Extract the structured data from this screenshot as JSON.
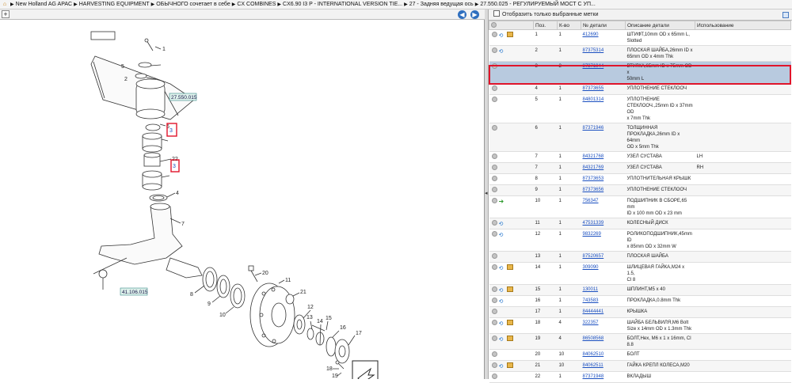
{
  "breadcrumb": [
    "New Holland AG APAC",
    "HARVESTING EQUIPMENT",
    "ОБЫЧНОГО сочетает в себе",
    "CX COMBINES",
    "CX6.90 I3 P - INTERNATIONAL VERSION TIE...",
    "27 - Задняя ведущая ось",
    "27.550.025 - РЕГУЛИРУЕМЫЙ МОСТ С УП..."
  ],
  "icons": {
    "home": "home-icon",
    "zoom": "zoom-plus-icon",
    "back": "arrow-left-icon",
    "fwd": "arrow-right-icon"
  },
  "filter_label": "Отобразить только выбранные метки",
  "columns": [
    "Поз.",
    "К-во",
    "№ детали",
    "Описание детали",
    "Использование"
  ],
  "diagram": {
    "refs": [
      "27.550.015",
      "41.106.015"
    ],
    "callouts": [
      "1",
      "5",
      "3",
      "6",
      "22",
      "4",
      "7",
      "20",
      "11",
      "21",
      "8",
      "9",
      "10",
      "12",
      "13",
      "15",
      "14",
      "16",
      "17",
      "18",
      "19"
    ],
    "hl": [
      "3",
      "3"
    ]
  },
  "rows": [
    {
      "pos": "1",
      "qty": "1",
      "pn": "412690",
      "desc": [
        "ШТИФТ,10mm OD x 65mm L,",
        "Slotted"
      ],
      "use": "",
      "icons": [
        "info",
        "swap",
        "box"
      ]
    },
    {
      "pos": "2",
      "qty": "1",
      "pn": "87375314",
      "desc": [
        "ПЛОСКАЯ ШАЙБА,26mm ID x",
        "65mm OD x 4mm Thk"
      ],
      "use": "",
      "icons": [
        "info",
        "swap"
      ]
    },
    {
      "pos": "3",
      "qty": "2",
      "pn": "87371944",
      "desc": [
        "ВТУЛКА,65mm ID x 75mm OD x",
        "50mm L"
      ],
      "use": "",
      "icons": [
        "info"
      ],
      "sel": true
    },
    {
      "pos": "4",
      "qty": "1",
      "pn": "87373655",
      "desc": [
        "УПЛОТНЕНИЕ СТЕКЛООЧ"
      ],
      "use": "",
      "icons": [
        "info"
      ]
    },
    {
      "pos": "5",
      "qty": "1",
      "pn": "84801314",
      "desc": [
        "УПЛОТНЕНИЕ",
        "СТЕКЛООЧ.,25mm ID x 37mm OD",
        "x 7mm Thk"
      ],
      "use": "",
      "icons": [
        "info"
      ]
    },
    {
      "pos": "6",
      "qty": "1",
      "pn": "87371946",
      "desc": [
        "ТОЛЩИННАЯ",
        "ПРОКЛАДКА,26mm ID x 64mm",
        "OD x 5mm Thk"
      ],
      "use": "",
      "icons": [
        "info"
      ]
    },
    {
      "pos": "7",
      "qty": "1",
      "pn": "84321768",
      "desc": [
        "УЗЕЛ СУСТАВА"
      ],
      "use": "LH",
      "icons": [
        "info"
      ]
    },
    {
      "pos": "7",
      "qty": "1",
      "pn": "84321769",
      "desc": [
        "УЗЕЛ СУСТАВА"
      ],
      "use": "RH",
      "icons": [
        "info"
      ]
    },
    {
      "pos": "8",
      "qty": "1",
      "pn": "87373653",
      "desc": [
        "УПЛОТНИТЕЛЬНАЯ КРЫШК"
      ],
      "use": "",
      "icons": [
        "info"
      ]
    },
    {
      "pos": "9",
      "qty": "1",
      "pn": "87373656",
      "desc": [
        "УПЛОТНЕНИЕ СТЕКЛООЧ"
      ],
      "use": "",
      "icons": [
        "info"
      ]
    },
    {
      "pos": "10",
      "qty": "1",
      "pn": "756347",
      "desc": [
        "ПОДШИПНИК В СБОРЕ,65 mm",
        "ID x 100 mm OD x 23 mm"
      ],
      "use": "",
      "icons": [
        "info",
        "grn"
      ]
    },
    {
      "pos": "11",
      "qty": "1",
      "pn": "47531339",
      "desc": [
        "КОЛЕСНЫЙ ДИСК"
      ],
      "use": "",
      "icons": [
        "info",
        "swap"
      ]
    },
    {
      "pos": "12",
      "qty": "1",
      "pn": "9832269",
      "desc": [
        "РОЛИКОПОДШИПНИК,45mm ID",
        "x 85mm OD x 32mm W"
      ],
      "use": "",
      "icons": [
        "info",
        "swap"
      ]
    },
    {
      "pos": "13",
      "qty": "1",
      "pn": "87520657",
      "desc": [
        "ПЛОСКАЯ ШАЙБА"
      ],
      "use": "",
      "icons": [
        "info"
      ]
    },
    {
      "pos": "14",
      "qty": "1",
      "pn": "309090",
      "desc": [
        "ШЛИЦЕВАЯ ГАЙКА,M24 x 1.5,",
        "Cl 8"
      ],
      "use": "",
      "icons": [
        "info",
        "swap",
        "box"
      ]
    },
    {
      "pos": "15",
      "qty": "1",
      "pn": "130011",
      "desc": [
        "ШПЛИНТ,M5 x 40"
      ],
      "use": "",
      "icons": [
        "info",
        "swap",
        "box"
      ]
    },
    {
      "pos": "16",
      "qty": "1",
      "pn": "743583",
      "desc": [
        "ПРОКЛАДКА,0.8mm Thk"
      ],
      "use": "",
      "icons": [
        "info",
        "swap"
      ]
    },
    {
      "pos": "17",
      "qty": "1",
      "pn": "84444441",
      "desc": [
        "КРЫШКА"
      ],
      "use": "",
      "icons": [
        "info"
      ]
    },
    {
      "pos": "18",
      "qty": "4",
      "pn": "322357",
      "desc": [
        "ШАЙБА БЕЛЬВИЛЯ,M6 Bolt",
        "Size x 14mm OD x 1.3mm Thk"
      ],
      "use": "",
      "icons": [
        "info",
        "swap",
        "box"
      ]
    },
    {
      "pos": "19",
      "qty": "4",
      "pn": "86508568",
      "desc": [
        "БОЛТ,Hex, M6 x 1 x 16mm, Cl",
        "8.8"
      ],
      "use": "",
      "icons": [
        "info",
        "swap",
        "box"
      ]
    },
    {
      "pos": "20",
      "qty": "10",
      "pn": "84062510",
      "desc": [
        "БОЛТ"
      ],
      "use": "",
      "icons": [
        "info"
      ]
    },
    {
      "pos": "21",
      "qty": "10",
      "pn": "84062511",
      "desc": [
        "ГАЙКА КРЕПЛ КОЛЕСА,M20"
      ],
      "use": "",
      "icons": [
        "info",
        "swap",
        "box"
      ]
    },
    {
      "pos": "22",
      "qty": "1",
      "pn": "87371948",
      "desc": [
        "ВКЛАДЫШ"
      ],
      "use": "",
      "icons": [
        "info"
      ]
    }
  ]
}
